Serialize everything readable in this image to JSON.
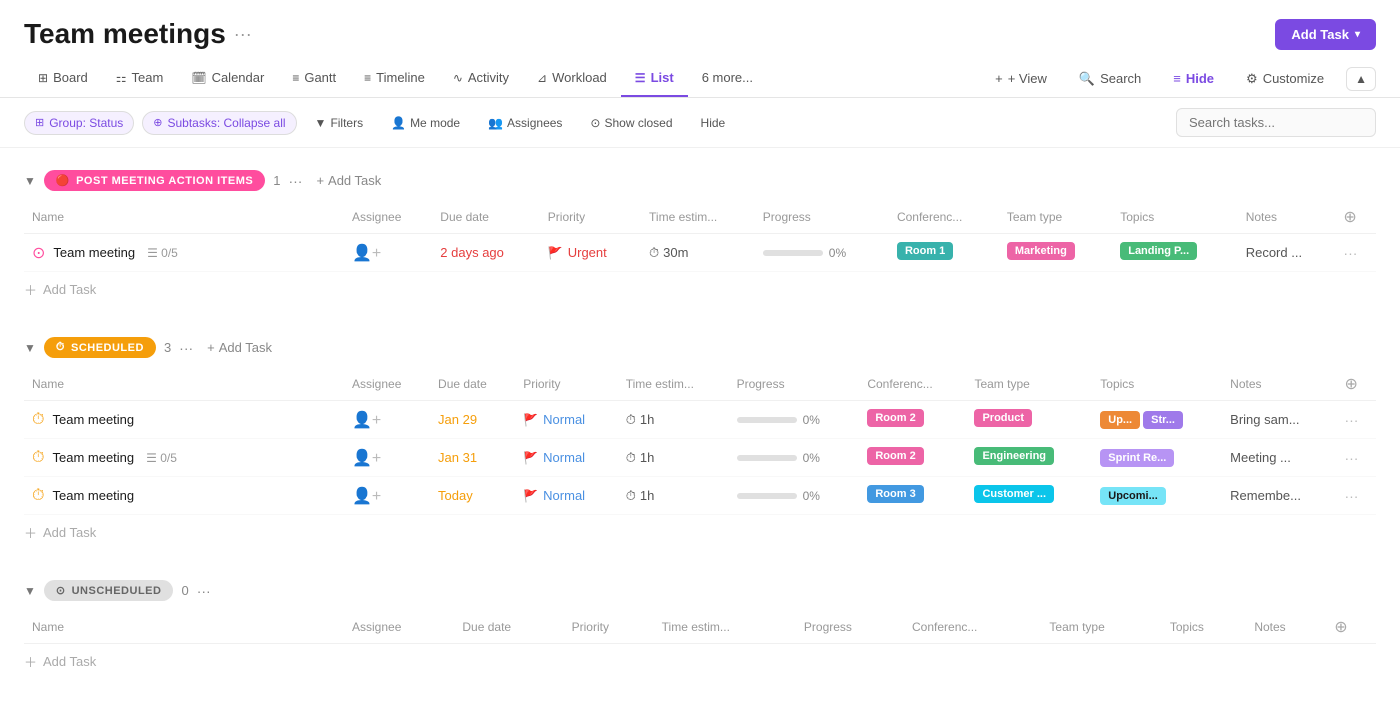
{
  "page": {
    "title": "Team meetings",
    "title_dots": "···",
    "add_task_label": "Add Task"
  },
  "nav": {
    "tabs": [
      {
        "id": "board",
        "label": "Board",
        "icon": "⊞",
        "active": false
      },
      {
        "id": "team",
        "label": "Team",
        "icon": "⚏",
        "active": false
      },
      {
        "id": "calendar",
        "label": "Calendar",
        "icon": "📅",
        "active": false
      },
      {
        "id": "gantt",
        "label": "Gantt",
        "icon": "≡",
        "active": false
      },
      {
        "id": "timeline",
        "label": "Timeline",
        "icon": "≡",
        "active": false
      },
      {
        "id": "activity",
        "label": "Activity",
        "icon": "∿",
        "active": false
      },
      {
        "id": "workload",
        "label": "Workload",
        "icon": "⊿",
        "active": false
      },
      {
        "id": "list",
        "label": "List",
        "icon": "☰",
        "active": true
      },
      {
        "id": "more",
        "label": "6 more...",
        "icon": "",
        "active": false
      }
    ],
    "view_btn": "+ View",
    "search_btn": "Search",
    "hide_btn": "Hide",
    "customize_btn": "Customize"
  },
  "filters": {
    "group_status": "Group: Status",
    "subtasks": "Subtasks: Collapse all",
    "filters_btn": "Filters",
    "me_mode_btn": "Me mode",
    "assignees_btn": "Assignees",
    "show_closed_btn": "Show closed",
    "hide_btn": "Hide",
    "search_placeholder": "Search tasks..."
  },
  "sections": [
    {
      "id": "post-meeting",
      "name": "POST MEETING ACTION ITEMS",
      "badge_type": "pink",
      "count": "1",
      "icon": "🔴",
      "tasks": [
        {
          "name": "Team meeting",
          "subtask_label": "0/5",
          "has_subtask": true,
          "assignee": "",
          "due_date": "2 days ago",
          "due_type": "overdue",
          "priority": "Urgent",
          "priority_type": "urgent",
          "time_estimate": "30m",
          "progress": 0,
          "conference": "Room 1",
          "conference_color": "teal",
          "team_type": "Marketing",
          "team_type_color": "pink",
          "topic": "Landing P...",
          "topic_color": "green",
          "notes": "Record ..."
        }
      ]
    },
    {
      "id": "scheduled",
      "name": "SCHEDULED",
      "badge_type": "yellow",
      "count": "3",
      "icon": "⏱",
      "tasks": [
        {
          "name": "Team meeting",
          "has_subtask": false,
          "assignee": "",
          "due_date": "Jan 29",
          "due_type": "normal",
          "priority": "Normal",
          "priority_type": "normal",
          "time_estimate": "1h",
          "progress": 0,
          "conference": "Room 2",
          "conference_color": "pink",
          "team_type": "Product",
          "team_type_color": "pink2",
          "topics": [
            {
              "label": "Up...",
              "color": "orange"
            },
            {
              "label": "Str...",
              "color": "purple"
            }
          ],
          "notes": "Bring sam..."
        },
        {
          "name": "Team meeting",
          "has_subtask": true,
          "subtask_label": "0/5",
          "assignee": "",
          "due_date": "Jan 31",
          "due_type": "normal",
          "priority": "Normal",
          "priority_type": "normal",
          "time_estimate": "1h",
          "progress": 0,
          "conference": "Room 2",
          "conference_color": "pink",
          "team_type": "Engineering",
          "team_type_color": "green",
          "topics": [
            {
              "label": "Sprint Re...",
              "color": "lavender"
            }
          ],
          "notes": "Meeting ..."
        },
        {
          "name": "Team meeting",
          "has_subtask": false,
          "assignee": "",
          "due_date": "Today",
          "due_type": "today",
          "priority": "Normal",
          "priority_type": "normal",
          "time_estimate": "1h",
          "progress": 0,
          "conference": "Room 3",
          "conference_color": "blue",
          "team_type": "Customer ...",
          "team_type_color": "blue2",
          "topics": [
            {
              "label": "Upcomi...",
              "color": "light-blue"
            }
          ],
          "notes": "Remembe..."
        }
      ]
    },
    {
      "id": "unscheduled",
      "name": "UNSCHEDULED",
      "badge_type": "gray",
      "count": "0",
      "icon": "⊙",
      "tasks": []
    }
  ],
  "table_headers": {
    "name": "Name",
    "assignee": "Assignee",
    "due_date": "Due date",
    "priority": "Priority",
    "time_estimate": "Time estim...",
    "progress": "Progress",
    "conference": "Conferenc...",
    "team_type": "Team type",
    "topics": "Topics",
    "notes": "Notes"
  },
  "add_task_label": "Add Task"
}
